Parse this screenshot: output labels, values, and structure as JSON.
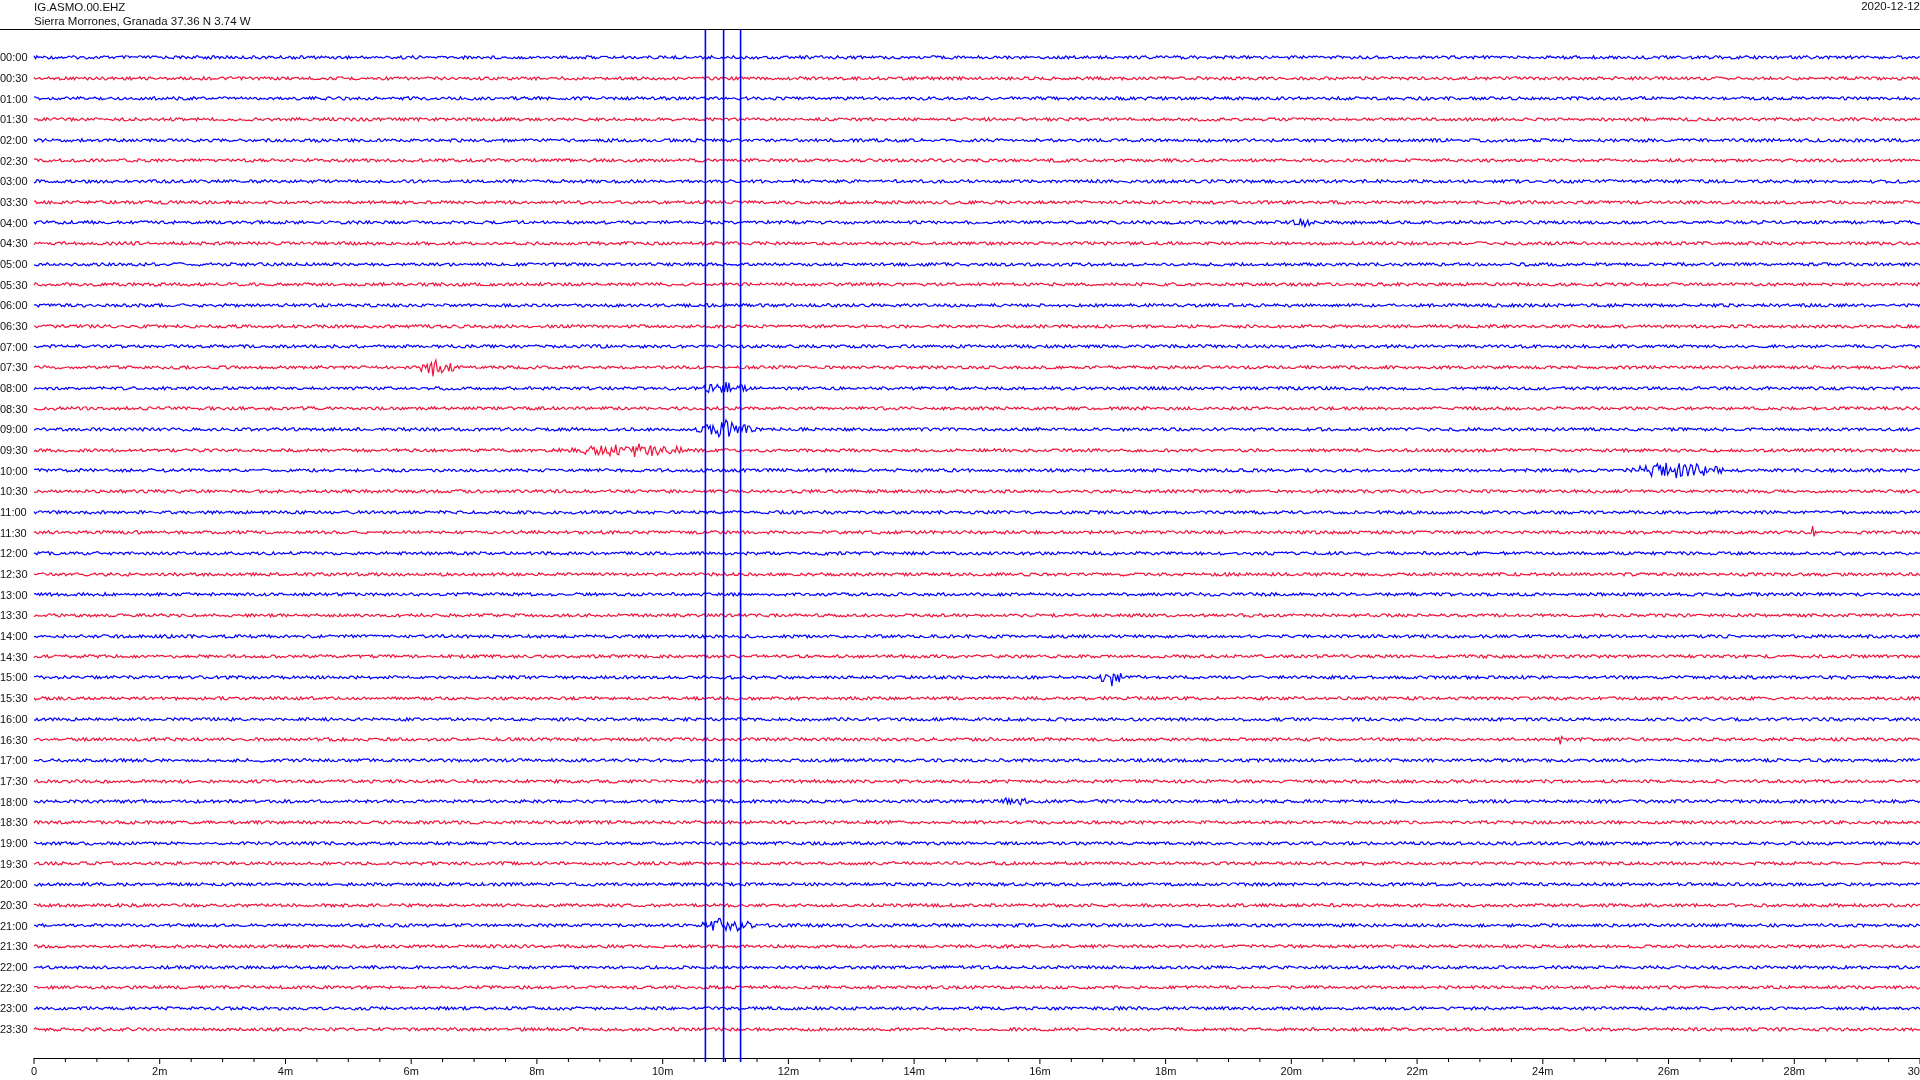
{
  "header": {
    "station": "IG.ASMO.00.EHZ",
    "location": "Sierra Morrones, Granada  37.36 N 3.74 W",
    "date": "2020-12-12"
  },
  "rows": [
    {
      "time": "00:00",
      "color": "#0000ff"
    },
    {
      "time": "00:30",
      "color": "#f0143c"
    },
    {
      "time": "01:00",
      "color": "#0000ff"
    },
    {
      "time": "01:30",
      "color": "#f0143c"
    },
    {
      "time": "02:00",
      "color": "#0000ff"
    },
    {
      "time": "02:30",
      "color": "#f0143c"
    },
    {
      "time": "03:00",
      "color": "#0000ff"
    },
    {
      "time": "03:30",
      "color": "#f0143c"
    },
    {
      "time": "04:00",
      "color": "#0000ff"
    },
    {
      "time": "04:30",
      "color": "#f0143c"
    },
    {
      "time": "05:00",
      "color": "#0000ff"
    },
    {
      "time": "05:30",
      "color": "#f0143c"
    },
    {
      "time": "06:00",
      "color": "#0000ff"
    },
    {
      "time": "06:30",
      "color": "#f0143c"
    },
    {
      "time": "07:00",
      "color": "#0000ff"
    },
    {
      "time": "07:30",
      "color": "#f0143c"
    },
    {
      "time": "08:00",
      "color": "#0000ff"
    },
    {
      "time": "08:30",
      "color": "#f0143c"
    },
    {
      "time": "09:00",
      "color": "#0000ff"
    },
    {
      "time": "09:30",
      "color": "#f0143c"
    },
    {
      "time": "10:00",
      "color": "#0000ff"
    },
    {
      "time": "10:30",
      "color": "#f0143c"
    },
    {
      "time": "11:00",
      "color": "#0000ff"
    },
    {
      "time": "11:30",
      "color": "#f0143c"
    },
    {
      "time": "12:00",
      "color": "#0000ff"
    },
    {
      "time": "12:30",
      "color": "#f0143c"
    },
    {
      "time": "13:00",
      "color": "#0000ff"
    },
    {
      "time": "13:30",
      "color": "#f0143c"
    },
    {
      "time": "14:00",
      "color": "#0000ff"
    },
    {
      "time": "14:30",
      "color": "#f0143c"
    },
    {
      "time": "15:00",
      "color": "#0000ff"
    },
    {
      "time": "15:30",
      "color": "#f0143c"
    },
    {
      "time": "16:00",
      "color": "#0000ff"
    },
    {
      "time": "16:30",
      "color": "#f0143c"
    },
    {
      "time": "17:00",
      "color": "#0000ff"
    },
    {
      "time": "17:30",
      "color": "#f0143c"
    },
    {
      "time": "18:00",
      "color": "#0000ff"
    },
    {
      "time": "18:30",
      "color": "#f0143c"
    },
    {
      "time": "19:00",
      "color": "#0000ff"
    },
    {
      "time": "19:30",
      "color": "#f0143c"
    },
    {
      "time": "20:00",
      "color": "#0000ff"
    },
    {
      "time": "20:30",
      "color": "#f0143c"
    },
    {
      "time": "21:00",
      "color": "#0000ff"
    },
    {
      "time": "21:30",
      "color": "#f0143c"
    },
    {
      "time": "22:00",
      "color": "#0000ff"
    },
    {
      "time": "22:30",
      "color": "#f0143c"
    },
    {
      "time": "23:00",
      "color": "#0000ff"
    },
    {
      "time": "23:30",
      "color": "#f0143c"
    }
  ],
  "x_axis": {
    "tick_labels": [
      "0",
      "2m",
      "4m",
      "6m",
      "8m",
      "10m",
      "12m",
      "14m",
      "16m",
      "18m",
      "20m",
      "22m",
      "24m",
      "26m",
      "28m",
      "30"
    ]
  }
}
